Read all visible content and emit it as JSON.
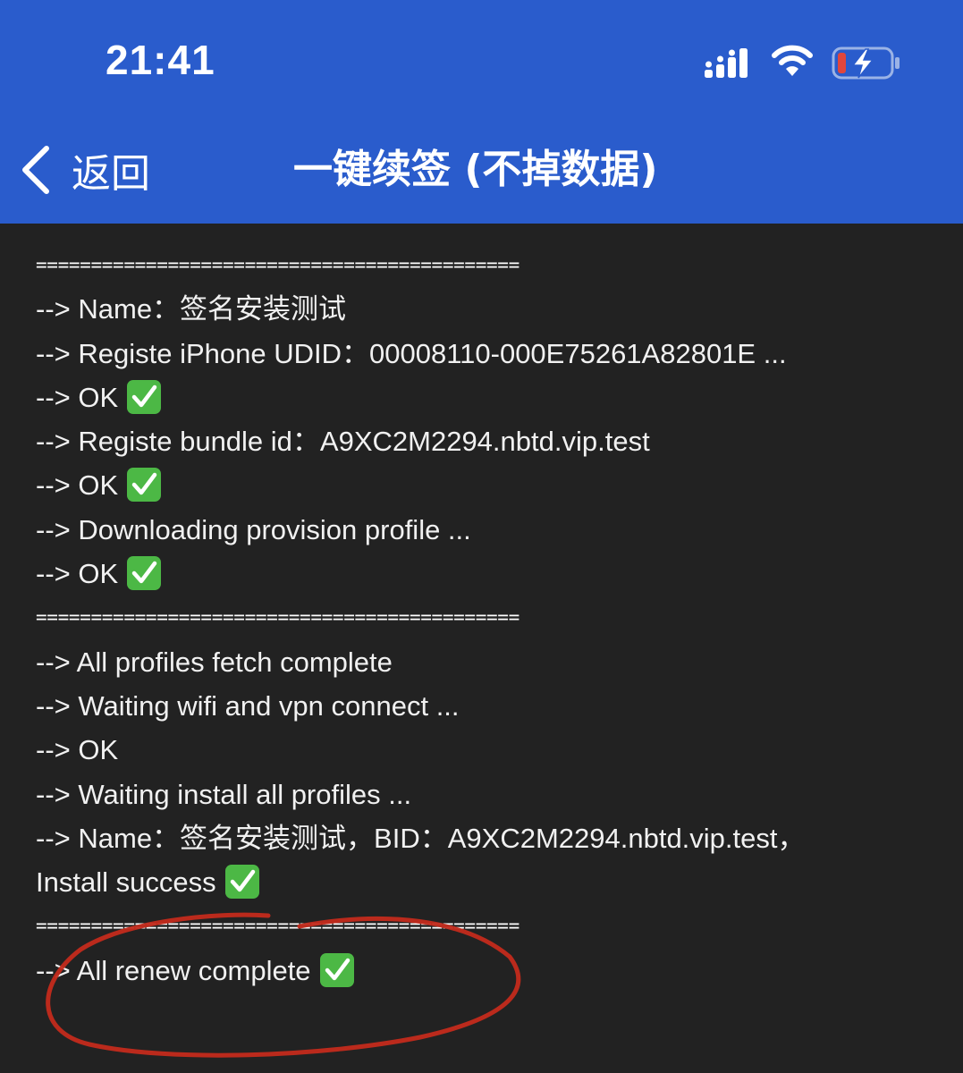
{
  "status_bar": {
    "time": "21:41"
  },
  "nav": {
    "back_label": "返回",
    "title": "一键续签 (不掉数据)"
  },
  "log": {
    "divider": "============================================",
    "lines": [
      "--> Name：签名安装测试",
      "--> Registe iPhone UDID：00008110-000E75261A82801E ...",
      "--> OK",
      "--> Registe bundle id：A9XC2M2294.nbtd.vip.test",
      "--> OK",
      "--> Downloading provision profile ...",
      "--> OK",
      "--> All profiles fetch complete",
      "--> Waiting wifi and vpn connect ...",
      "--> OK",
      "--> Waiting install all profiles ...",
      "--> Name：签名安装测试，BID：A9XC2M2294.nbtd.vip.test，",
      "Install success",
      "--> All renew complete"
    ]
  },
  "icons": {
    "signal": "cellular-signal-icon",
    "wifi": "wifi-icon",
    "battery": "battery-charging-icon",
    "back": "chevron-left-icon",
    "check": "check-mark-button-icon"
  },
  "colors": {
    "header_bg": "#2a5ccc",
    "console_bg": "#222222",
    "console_text": "#f1f1f1",
    "check_green": "#4cb845",
    "battery_low_red": "#e0463d",
    "annotation_red": "#c42b1c"
  }
}
